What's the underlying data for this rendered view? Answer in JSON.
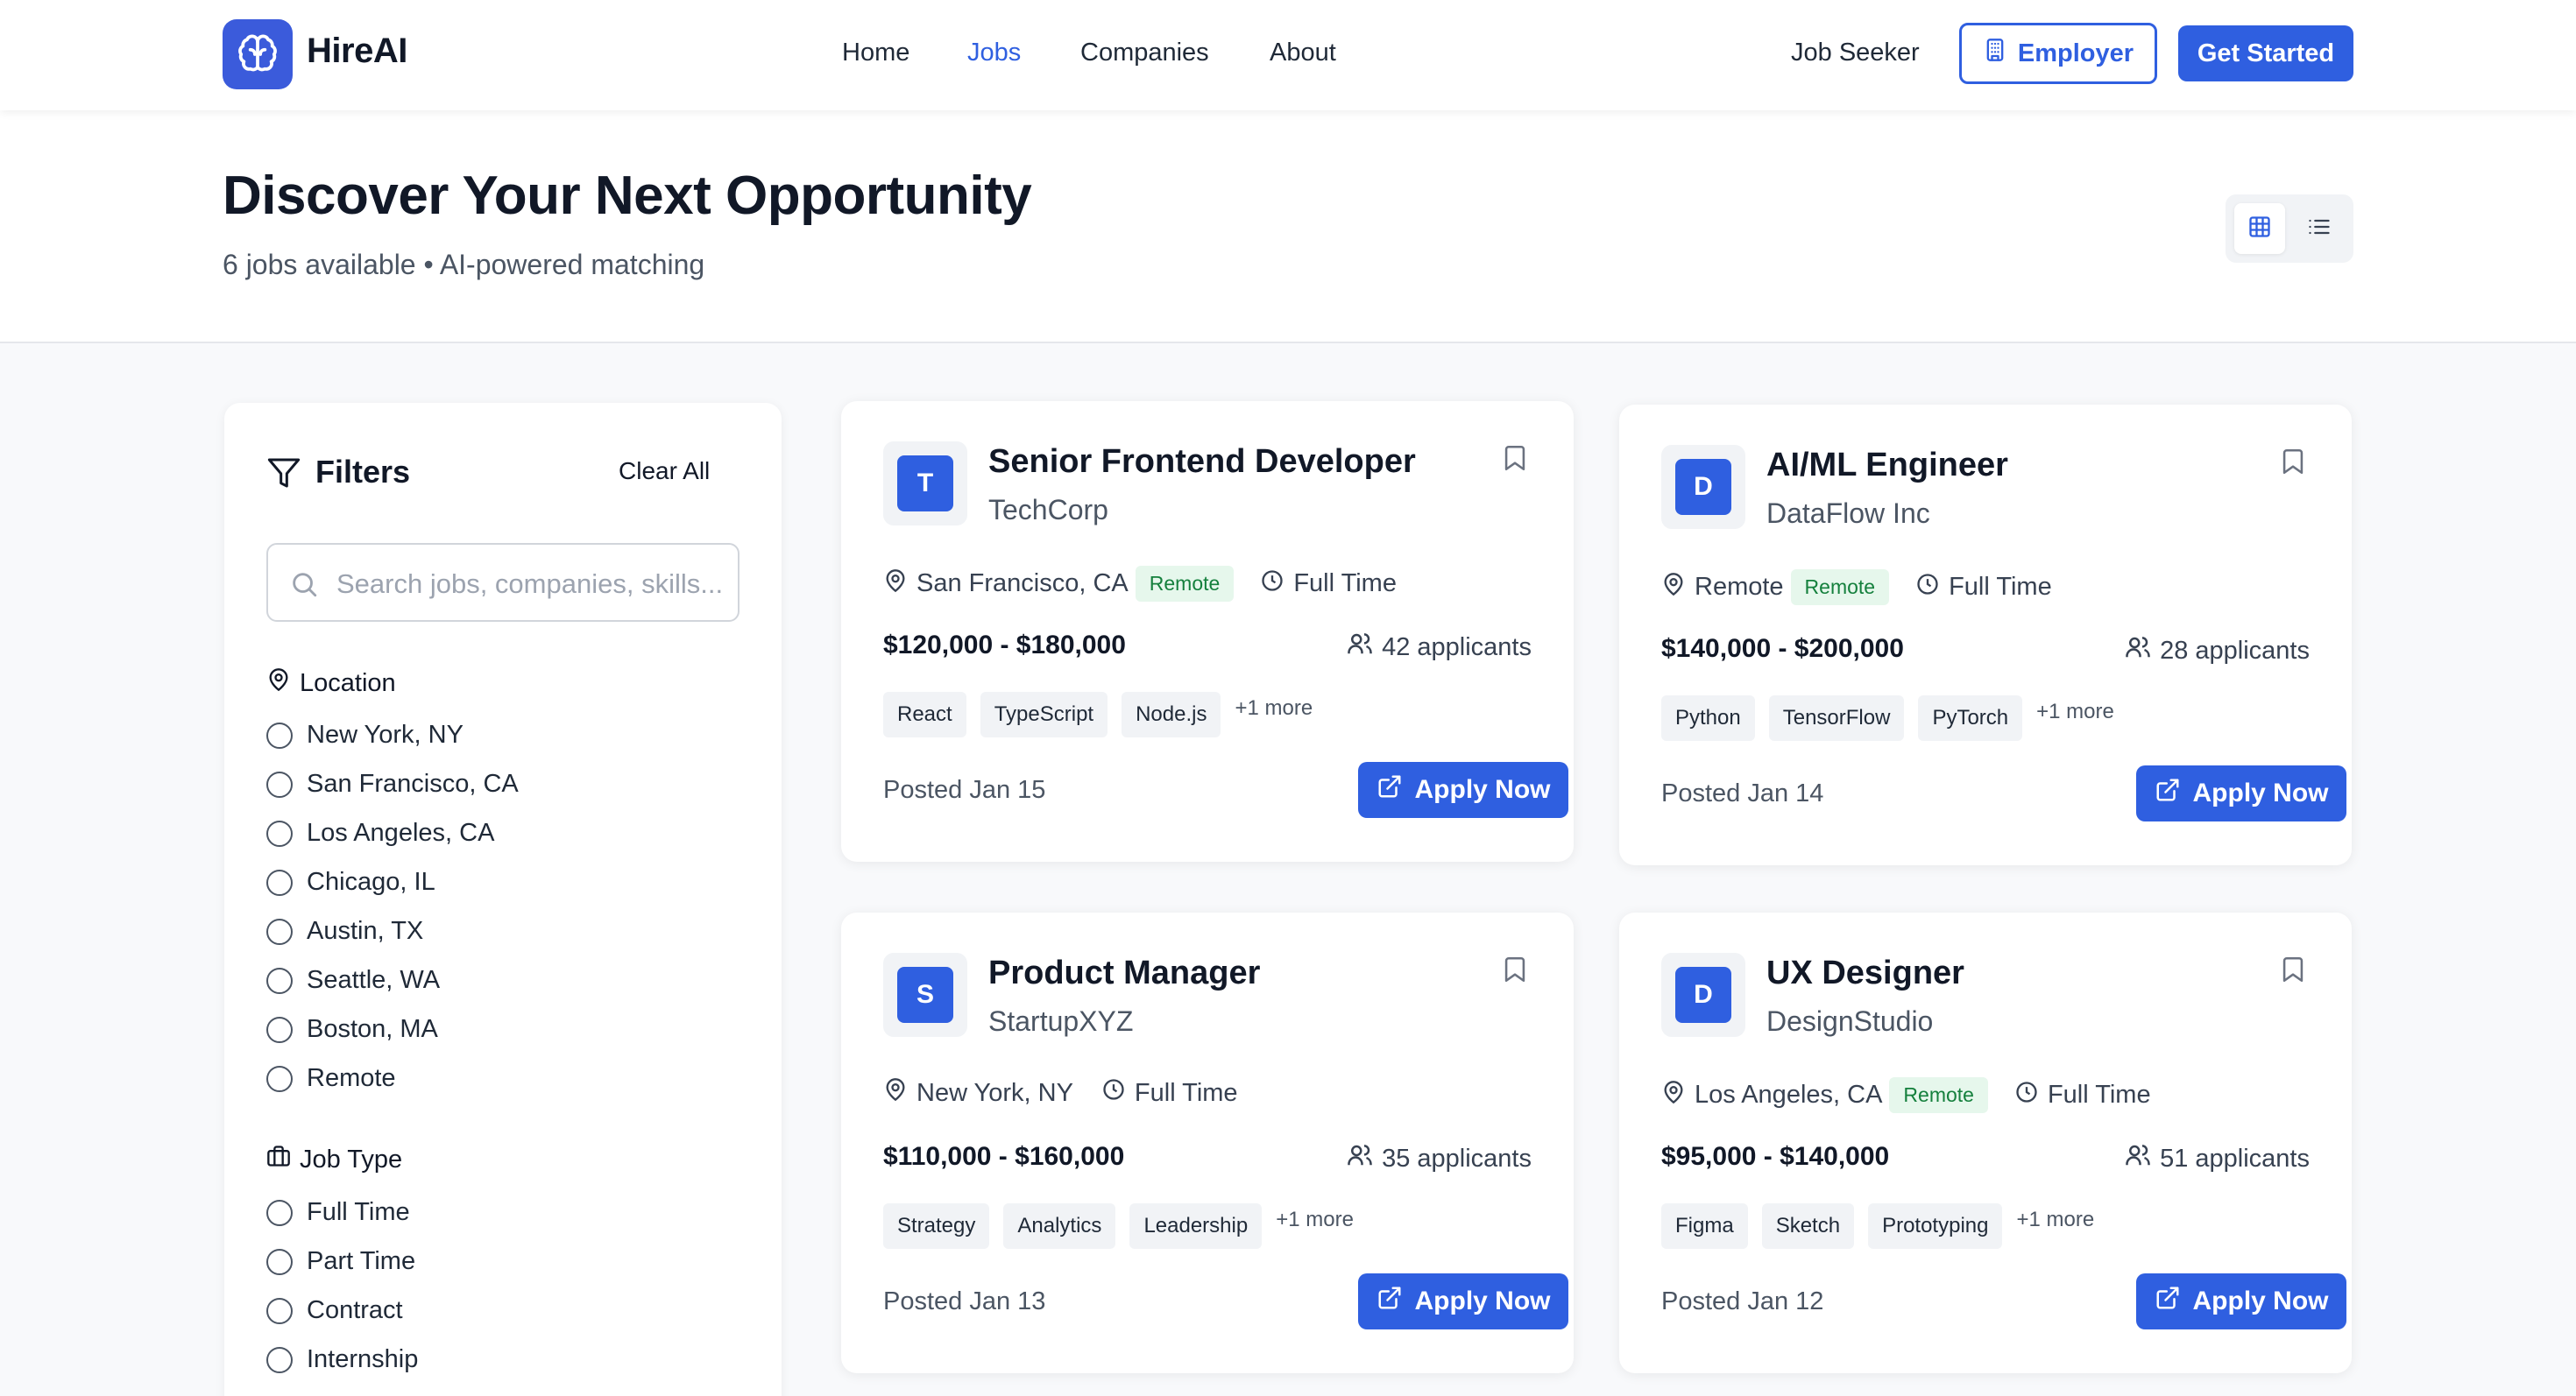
{
  "brand": {
    "name": "HireAI",
    "logo_icon": "brain-icon",
    "accent": "#2f5fe0"
  },
  "nav": {
    "links": [
      {
        "label": "Home",
        "active": false
      },
      {
        "label": "Jobs",
        "active": true
      },
      {
        "label": "Companies",
        "active": false
      },
      {
        "label": "About",
        "active": false
      }
    ],
    "job_seeker": "Job Seeker",
    "employer": "Employer",
    "get_started": "Get Started"
  },
  "hero": {
    "title": "Discover Your Next Opportunity",
    "subtitle": "6 jobs available • AI-powered matching",
    "view_mode": "grid"
  },
  "filters": {
    "title": "Filters",
    "clear_all": "Clear All",
    "search_placeholder": "Search jobs, companies, skills...",
    "location": {
      "label": "Location",
      "options": [
        "New York, NY",
        "San Francisco, CA",
        "Los Angeles, CA",
        "Chicago, IL",
        "Austin, TX",
        "Seattle, WA",
        "Boston, MA",
        "Remote"
      ]
    },
    "job_type": {
      "label": "Job Type",
      "options": [
        "Full Time",
        "Part Time",
        "Contract",
        "Internship"
      ]
    }
  },
  "jobs": [
    {
      "initial": "T",
      "title": "Senior Frontend Developer",
      "company": "TechCorp",
      "location": "San Francisco, CA",
      "remote": "Remote",
      "type": "Full Time",
      "salary": "$120,000 - $180,000",
      "applicants": "42 applicants",
      "tags": [
        "React",
        "TypeScript",
        "Node.js"
      ],
      "more": "+1 more",
      "posted": "Posted Jan 15",
      "apply": "Apply Now"
    },
    {
      "initial": "D",
      "title": "AI/ML Engineer",
      "company": "DataFlow Inc",
      "location": "Remote",
      "remote": "Remote",
      "type": "Full Time",
      "salary": "$140,000 - $200,000",
      "applicants": "28 applicants",
      "tags": [
        "Python",
        "TensorFlow",
        "PyTorch"
      ],
      "more": "+1 more",
      "posted": "Posted Jan 14",
      "apply": "Apply Now"
    },
    {
      "initial": "S",
      "title": "Product Manager",
      "company": "StartupXYZ",
      "location": "New York, NY",
      "remote": "",
      "type": "Full Time",
      "salary": "$110,000 - $160,000",
      "applicants": "35 applicants",
      "tags": [
        "Strategy",
        "Analytics",
        "Leadership"
      ],
      "more": "+1 more",
      "posted": "Posted Jan 13",
      "apply": "Apply Now"
    },
    {
      "initial": "D",
      "title": "UX Designer",
      "company": "DesignStudio",
      "location": "Los Angeles, CA",
      "remote": "Remote",
      "type": "Full Time",
      "salary": "$95,000 - $140,000",
      "applicants": "51 applicants",
      "tags": [
        "Figma",
        "Sketch",
        "Prototyping"
      ],
      "more": "+1 more",
      "posted": "Posted Jan 12",
      "apply": "Apply Now"
    }
  ]
}
